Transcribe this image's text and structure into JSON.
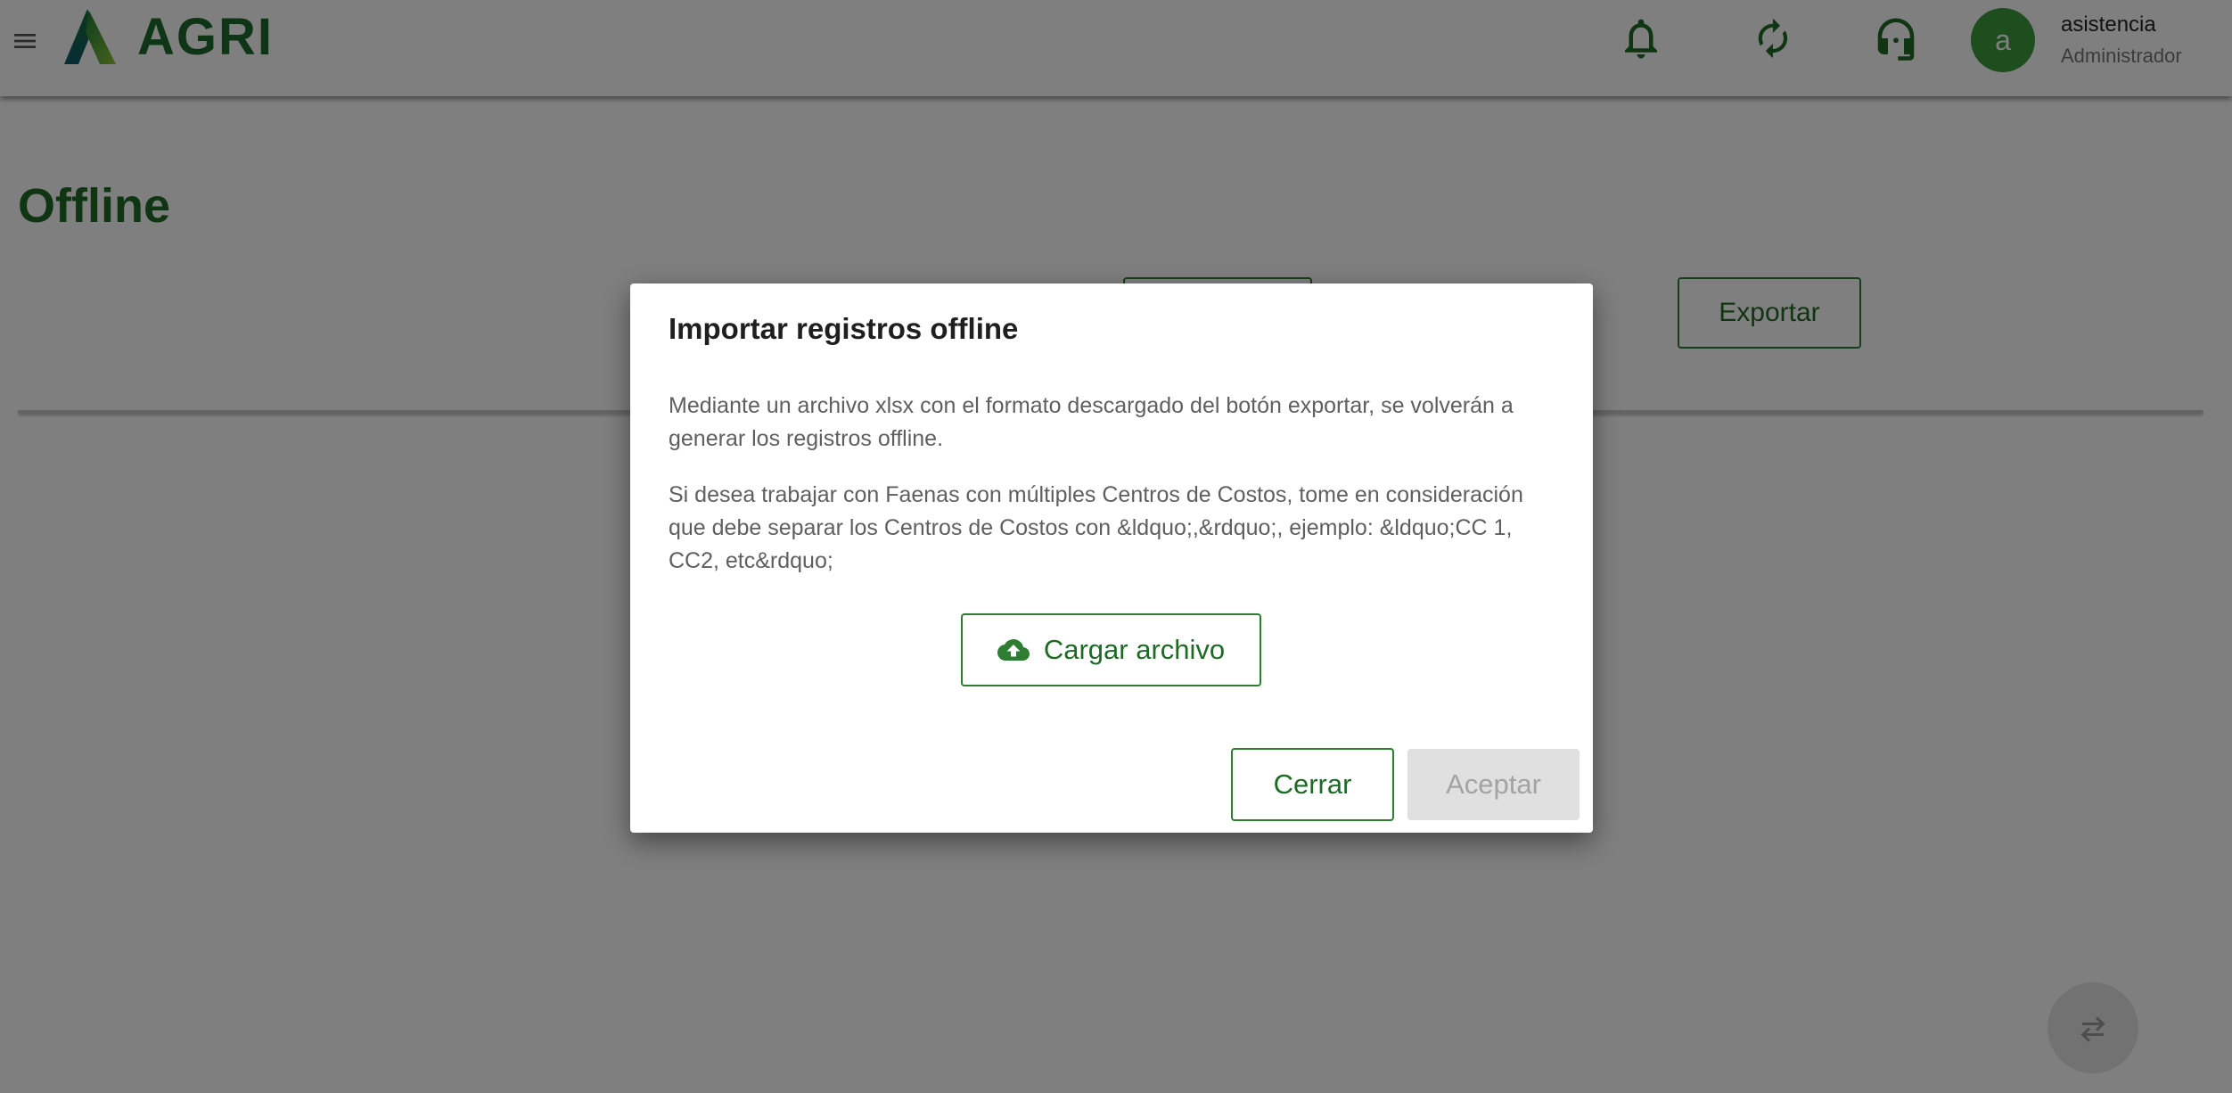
{
  "header": {
    "logo_text": "AGRI",
    "user": {
      "avatar_letter": "a",
      "name": "asistencia",
      "role": "Administrador"
    }
  },
  "page": {
    "title": "Offline",
    "export_label": "Exportar"
  },
  "dialog": {
    "title": "Importar registros offline",
    "paragraph1": "Mediante un archivo xlsx con el formato descargado del botón exportar, se volverán a generar los registros offline.",
    "paragraph2": "Si desea trabajar con Faenas con múltiples Centros de Costos, tome en consideración que debe separar los Centros de Costos con &ldquo;,&rdquo;, ejemplo: &ldquo;CC 1, CC2, etc&rdquo;",
    "upload_label": "Cargar archivo",
    "close_label": "Cerrar",
    "accept_label": "Aceptar"
  },
  "colors": {
    "primary_green": "#2e7d32",
    "dark_green": "#1e6b25",
    "avatar_green": "#3d9a3d",
    "disabled_bg": "#e0e0e0"
  },
  "icons": [
    "menu-icon",
    "bell-icon",
    "sync-icon",
    "headset-icon",
    "cloud-upload-icon",
    "swap-icon"
  ]
}
